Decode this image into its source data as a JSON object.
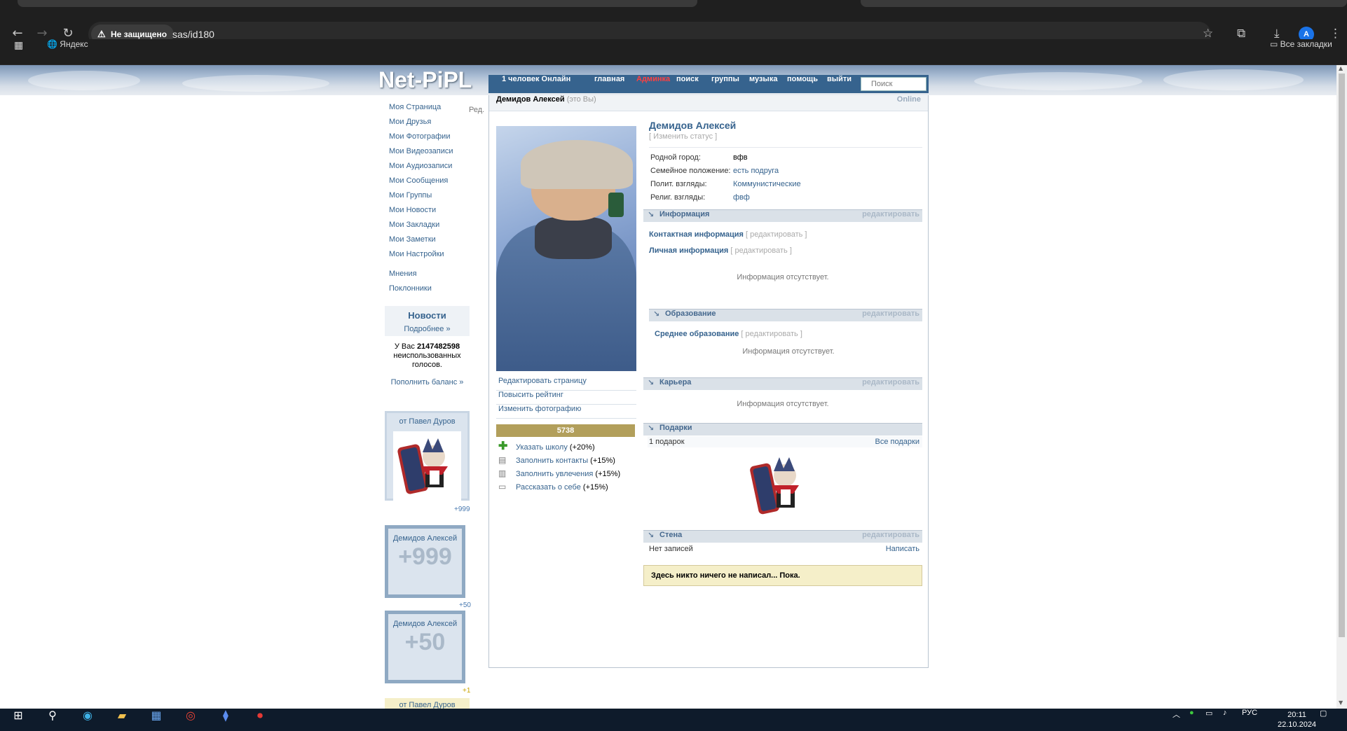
{
  "browser": {
    "security_label": "Не защищено",
    "url": "sas/id180",
    "bookmarks": {
      "yandex": "Яндекс",
      "all": "Все закладки"
    },
    "profile_initial": "A"
  },
  "site": {
    "logo": "Net-PiPL",
    "nav": {
      "online": "1 человек Онлайн",
      "home": "главная",
      "admin": "Админка",
      "search": "поиск",
      "groups": "группы",
      "music": "музыка",
      "help": "помощь",
      "logout": "выйти",
      "search_placeholder": "Поиск"
    }
  },
  "sidebar": {
    "edit_label": "Ред.",
    "links": [
      "Моя Страница",
      "Мои Друзья",
      "Мои Фотографии",
      "Мои Видеозаписи",
      "Мои Аудиозаписи",
      "Мои Сообщения",
      "Мои Группы",
      "Мои Новости",
      "Мои Закладки",
      "Мои Заметки",
      "Мои Настройки"
    ],
    "extra": [
      "Мнения",
      "Поклонники"
    ],
    "news_title": "Новости",
    "news_more": "Подробнее »",
    "votes_prefix": "У Вас",
    "votes_count": "2147482598",
    "votes_suffix": "неиспользованных голосов.",
    "topup": "Пополнить баланс »",
    "gift_from": "от Павел Дуров",
    "count1": "+999",
    "card1_name": "Демидов Алексей",
    "card1_num": "+999",
    "count2": "+50",
    "card2_name": "Демидов Алексей",
    "card2_num": "+50",
    "count3": "+1",
    "gift_from2": "от Павел Дуров"
  },
  "profile": {
    "header_name": "Демидов Алексей",
    "header_you": "(это Вы)",
    "header_status": "Online",
    "name": "Демидов Алексей",
    "change_status": "[ Изменить статус ]",
    "info": [
      {
        "k": "Родной город:",
        "v": "вфв"
      },
      {
        "k": "Семейное положение:",
        "v": "есть подруга"
      },
      {
        "k": "Полит. взгляды:",
        "v": "Коммунистические"
      },
      {
        "k": "Религ. взгляды:",
        "v": "фвф"
      }
    ],
    "actions": [
      "Редактировать страницу",
      "Повысить рейтинг",
      "Изменить фотографию"
    ],
    "rating": "5738",
    "todos": [
      {
        "link": "Указать школу",
        "bonus": "(+20%)"
      },
      {
        "link": "Заполнить контакты",
        "bonus": "(+15%)"
      },
      {
        "link": "Заполнить увлечения",
        "bonus": "(+15%)"
      },
      {
        "link": "Рассказать о себе",
        "bonus": "(+15%)"
      }
    ],
    "edit_word": "редактировать",
    "edit_bracket": "[ редактировать ]",
    "sections": {
      "info": "Информация",
      "contacts": "Контактная информация",
      "personal": "Личная информация",
      "no_info": "Информация отсутствует.",
      "education": "Образование",
      "secondary": "Среднее образование",
      "career": "Карьера",
      "gifts": "Подарки",
      "gifts_count": "1 подарок",
      "all_gifts": "Все подарки",
      "wall": "Стена",
      "no_posts": "Нет записей",
      "write": "Написать",
      "wall_note": "Здесь никто ничего не написал... Пока."
    }
  },
  "taskbar": {
    "lang": "РУС",
    "time": "20:11",
    "date": "22.10.2024"
  }
}
